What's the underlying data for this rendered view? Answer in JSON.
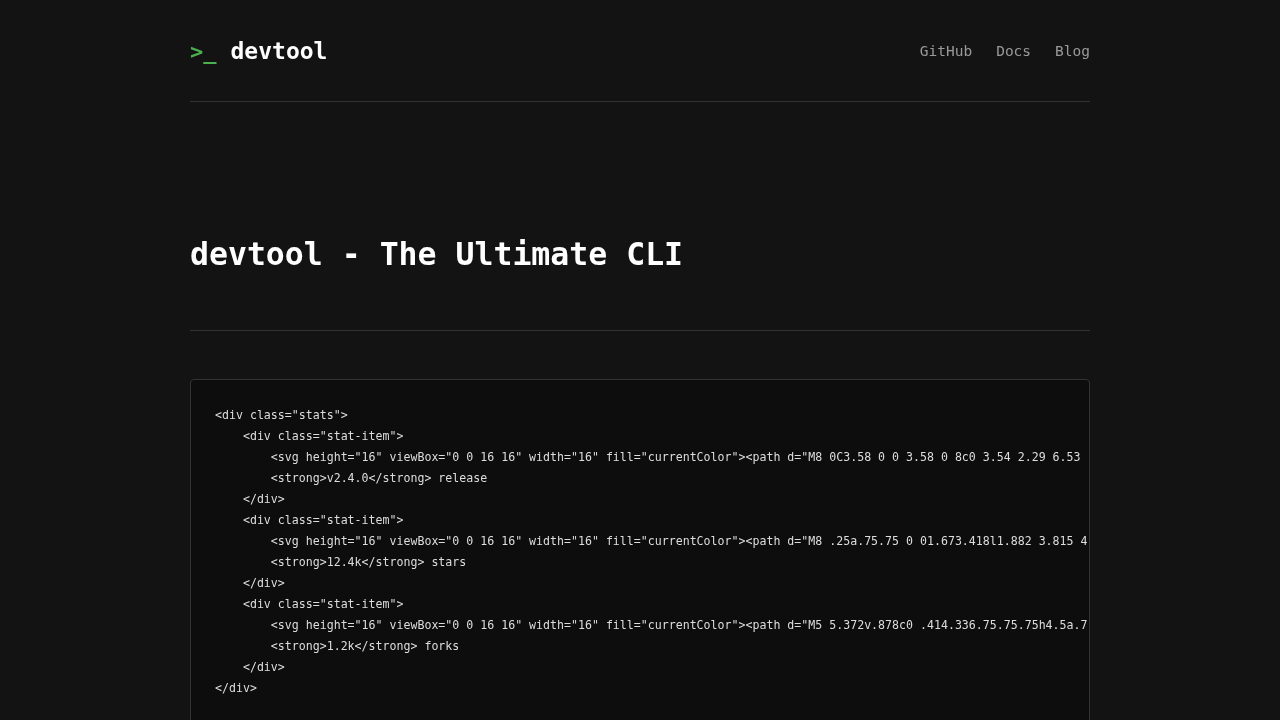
{
  "header": {
    "logo_prompt": ">_",
    "logo_name": "devtool",
    "nav": [
      "GitHub",
      "Docs",
      "Blog"
    ]
  },
  "title": "devtool - The Ultimate CLI",
  "code_lines": [
    "<div class=\"stats\">",
    "    <div class=\"stat-item\">",
    "        <svg height=\"16\" viewBox=\"0 0 16 16\" width=\"16\" fill=\"currentColor\"><path d=\"M8 0C3.58 0 0 3.58 0 8c0 3.54 2.29 6.53",
    "        <strong>v2.4.0</strong> release",
    "    </div>",
    "    <div class=\"stat-item\">",
    "        <svg height=\"16\" viewBox=\"0 0 16 16\" width=\"16\" fill=\"currentColor\"><path d=\"M8 .25a.75.75 0 01.673.418l1.882 3.815 4",
    "        <strong>12.4k</strong> stars",
    "    </div>",
    "    <div class=\"stat-item\">",
    "        <svg height=\"16\" viewBox=\"0 0 16 16\" width=\"16\" fill=\"currentColor\"><path d=\"M5 5.372v.878c0 .414.336.75.75.75h4.5a.7",
    "        <strong>1.2k</strong> forks",
    "    </div>",
    "</div>"
  ]
}
